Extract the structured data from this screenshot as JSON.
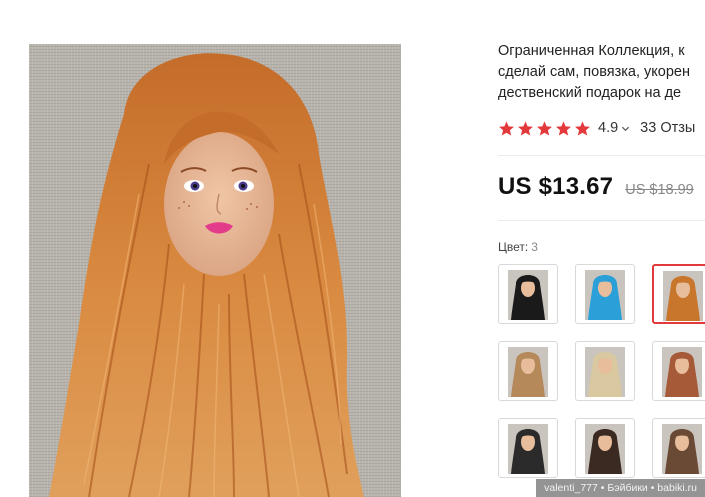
{
  "product": {
    "title_lines": [
      "Ограниченная Коллекция, к",
      "сделай сам, повязка, укорен",
      "дественский подарок на де"
    ],
    "rating": "4.9",
    "reviews": "33 Отзы",
    "rating_stars": 5,
    "price": "US $13.67",
    "old_price": "US $18.99",
    "color_label": "Цвет:",
    "color_count": "3",
    "selected_swatch": 3,
    "swatches": [
      {
        "name": "black-hair",
        "hair": "#1a1a1a"
      },
      {
        "name": "blue-hair",
        "hair": "#2a9fd8"
      },
      {
        "name": "ginger-hair",
        "hair": "#c9762d"
      },
      {
        "name": "light-brown-hair",
        "hair": "#b5895a"
      },
      {
        "name": "blonde-hair",
        "hair": "#d9c8a0"
      },
      {
        "name": "auburn-hair",
        "hair": "#a65a38"
      },
      {
        "name": "dark-hair-head",
        "hair": "#2b2b2b"
      },
      {
        "name": "short-dark-hair",
        "hair": "#3a2a22"
      },
      {
        "name": "curly-hair",
        "hair": "#6b4a35"
      }
    ]
  },
  "colors": {
    "star": "#e4393c",
    "selected_border": "#e4393c"
  },
  "watermark": "valenti_777 • Бэйбики • babiki.ru"
}
